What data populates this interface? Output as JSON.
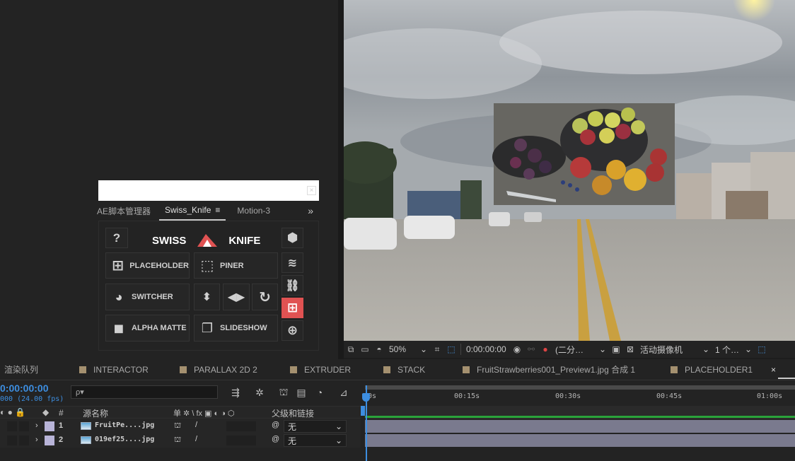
{
  "viewer_bar": {
    "zoom": "50%",
    "timecode": "0:00:00:00",
    "resolution": "(二分…",
    "camera": "活动摄像机",
    "views": "1 个…"
  },
  "swiss_knife": {
    "tabs": [
      "AE脚本管理器",
      "Swiss_Knife",
      "Motion-3"
    ],
    "more": "»",
    "close": "×",
    "brand_left": "SWISS",
    "brand_right": "KNIFE",
    "help": "?",
    "buttons": {
      "placeholder": "PLACEHOLDER",
      "piner": "PINER",
      "switcher": "SWITCHER",
      "alpha_matte": "ALPHA MATTE",
      "slideshow": "SLIDESHOW"
    },
    "accent": "#e05252"
  },
  "timeline": {
    "tabs": [
      {
        "label": "渲染队列",
        "swatch": false
      },
      {
        "label": "INTERACTOR",
        "swatch": true
      },
      {
        "label": "PARALLAX 2D 2",
        "swatch": true
      },
      {
        "label": "EXTRUDER",
        "swatch": true
      },
      {
        "label": "STACK",
        "swatch": true
      },
      {
        "label": "FruitStrawberries001_Preview1.jpg 合成 1",
        "swatch": true
      },
      {
        "label": "PLACEHOLDER1",
        "swatch": true
      }
    ],
    "close": "×",
    "timecode": "0:00:00:00",
    "fps": "000 (24.00 fps)",
    "search_placeholder": "ρ▾",
    "column_headers": {
      "hash": "#",
      "source_name": "源名称",
      "switches": "单 ✲ \\ fx ▣ ◐ ◑ ⬡",
      "parent": "父级和链接"
    },
    "layers": [
      {
        "num": "1",
        "name": "FruitPe....jpg",
        "parent": "无"
      },
      {
        "num": "2",
        "name": "019ef25....jpg",
        "parent": "无"
      }
    ],
    "ruler_labels": [
      "0s",
      "00:15s",
      "00:30s",
      "00:45s",
      "01:00s"
    ]
  }
}
